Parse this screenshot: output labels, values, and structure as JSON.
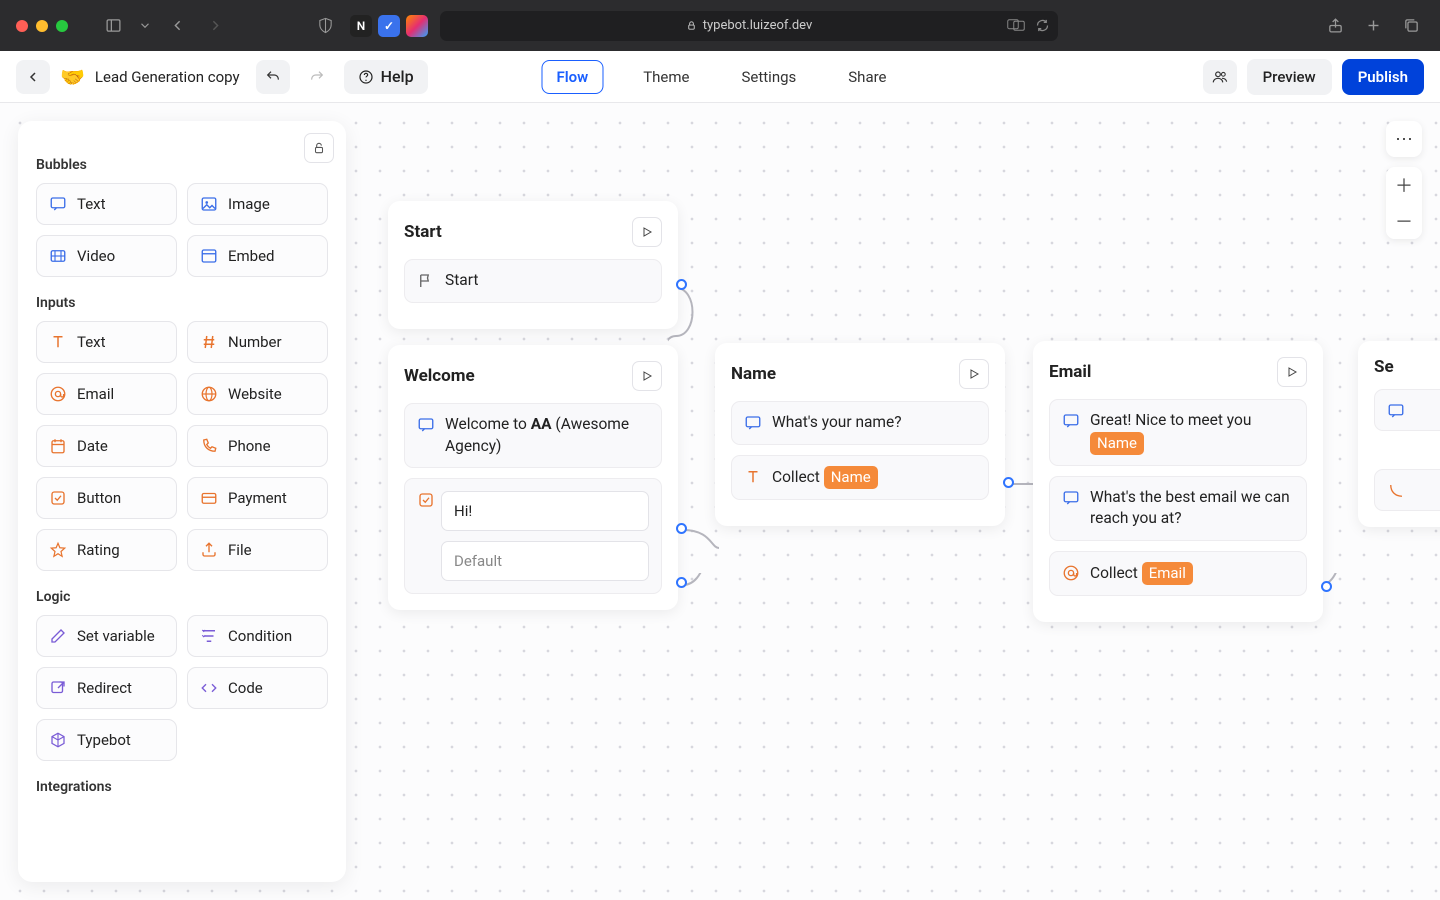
{
  "browser": {
    "url": "typebot.luizeof.dev"
  },
  "header": {
    "emoji": "🤝",
    "title": "Lead Generation copy",
    "help": "Help",
    "nav": {
      "flow": "Flow",
      "theme": "Theme",
      "settings": "Settings",
      "share": "Share"
    },
    "preview": "Preview",
    "publish": "Publish"
  },
  "sidebar": {
    "sections": {
      "bubbles": "Bubbles",
      "inputs": "Inputs",
      "logic": "Logic",
      "integrations": "Integrations"
    },
    "bubbles": {
      "text": "Text",
      "image": "Image",
      "video": "Video",
      "embed": "Embed"
    },
    "inputs": {
      "text": "Text",
      "number": "Number",
      "email": "Email",
      "website": "Website",
      "date": "Date",
      "phone": "Phone",
      "button": "Button",
      "payment": "Payment",
      "rating": "Rating",
      "file": "File"
    },
    "logic": {
      "set_variable": "Set variable",
      "condition": "Condition",
      "redirect": "Redirect",
      "code": "Code",
      "typebot": "Typebot"
    }
  },
  "nodes": {
    "start": {
      "title": "Start",
      "step": "Start"
    },
    "welcome": {
      "title": "Welcome",
      "msg_prefix": "Welcome to ",
      "msg_bold": "AA",
      "msg_suffix": " (Awesome Agency)",
      "choice_value": "Hi!",
      "choice_default": "Default"
    },
    "name": {
      "title": "Name",
      "msg": "What's your name?",
      "collect_prefix": "Collect ",
      "collect_var": "Name"
    },
    "email": {
      "title": "Email",
      "msg1": "Great! Nice to meet you ",
      "msg1_var": "Name",
      "msg2": "What's the best email we can reach you at?",
      "collect_prefix": "Collect ",
      "collect_var": "Email"
    },
    "extra": {
      "title": "Se"
    }
  }
}
